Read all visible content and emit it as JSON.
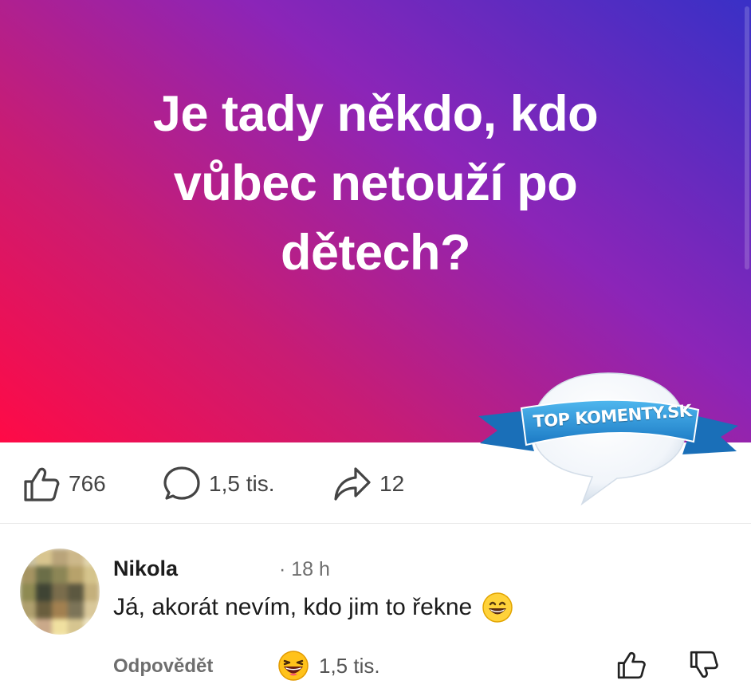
{
  "post": {
    "headline_lines": [
      "Je tady někdo, kdo",
      "vůbec netouží po",
      "dětech?"
    ],
    "gradient_colors": [
      "#ff0a46",
      "#c91c73",
      "#8b25b8",
      "#3930c6"
    ]
  },
  "watermark": {
    "text": "TOP KOMENTY.SK",
    "ribbon_color": "#2c97d8"
  },
  "actions": {
    "likes": {
      "icon": "thumb-up-icon",
      "count": "766"
    },
    "comments": {
      "icon": "comment-bubble-icon",
      "count": "1,5 tis."
    },
    "shares": {
      "icon": "share-arrow-icon",
      "count": "12"
    }
  },
  "comment": {
    "author": "Nikola",
    "time": "· 18 h",
    "text": "Já, akorát nevím, kdo jim to řekne",
    "text_emoji": "grinning-face-icon",
    "reply_label": "Odpovědět",
    "reaction": {
      "icon": "laughing-face-icon",
      "count": "1,5 tis."
    },
    "upvote_icon": "thumb-up-icon",
    "downvote_icon": "thumb-down-icon"
  }
}
